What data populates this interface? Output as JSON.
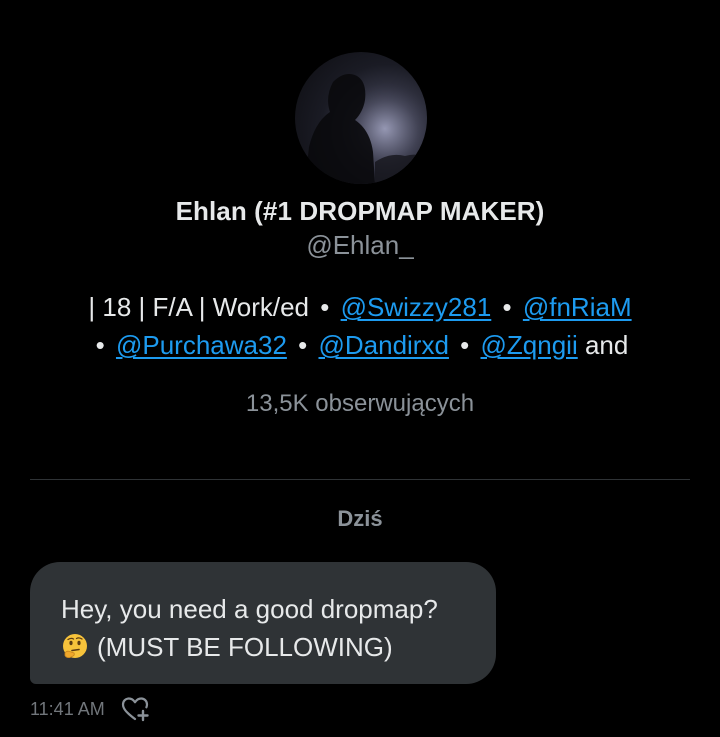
{
  "profile": {
    "avatar_icon": "profile-avatar",
    "display_name": "Ehlan (#1 DROPMAP MAKER)",
    "handle": "@Ehlan_",
    "bio": {
      "prefix": "| 18 | F/A | Work/ed",
      "separator": "•",
      "mentions": [
        "@Swizzy281",
        "@fnRiaM",
        "@Purchawa32",
        "@Dandirxd",
        "@Zqngii"
      ],
      "suffix": "and"
    },
    "followers": "13,5K obserwujących"
  },
  "conversation": {
    "day_label": "Dziś",
    "messages": [
      {
        "line1": "Hey, you need a good dropmap?",
        "emoji_icon": "thinking-face-icon",
        "line2": "(MUST BE FOLLOWING)",
        "time": "11:41 AM",
        "reaction_icon": "add-reaction-heart-icon"
      }
    ]
  },
  "colors": {
    "background": "#000000",
    "primary_text": "#e7e9ea",
    "secondary_text": "#8b9299",
    "link": "#1d9bf0",
    "bubble": "#2f3336",
    "divider": "#2f3336"
  }
}
